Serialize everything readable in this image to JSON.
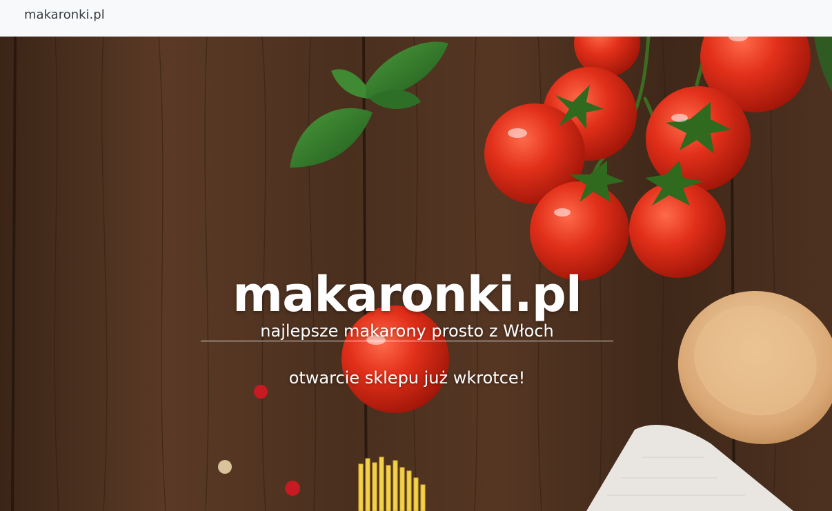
{
  "navbar": {
    "brand": "makaronki.pl"
  },
  "hero": {
    "title": "makaronki.pl",
    "subtitle": "najlepsze makarony prosto z Włoch",
    "notice": "otwarcie sklepu już wkrotce!"
  },
  "colors": {
    "navbar_bg": "#f8f9fa",
    "wood": "#4a3020",
    "tomato": "#e0301a",
    "basil": "#2f7a2a",
    "text": "#ffffff"
  }
}
